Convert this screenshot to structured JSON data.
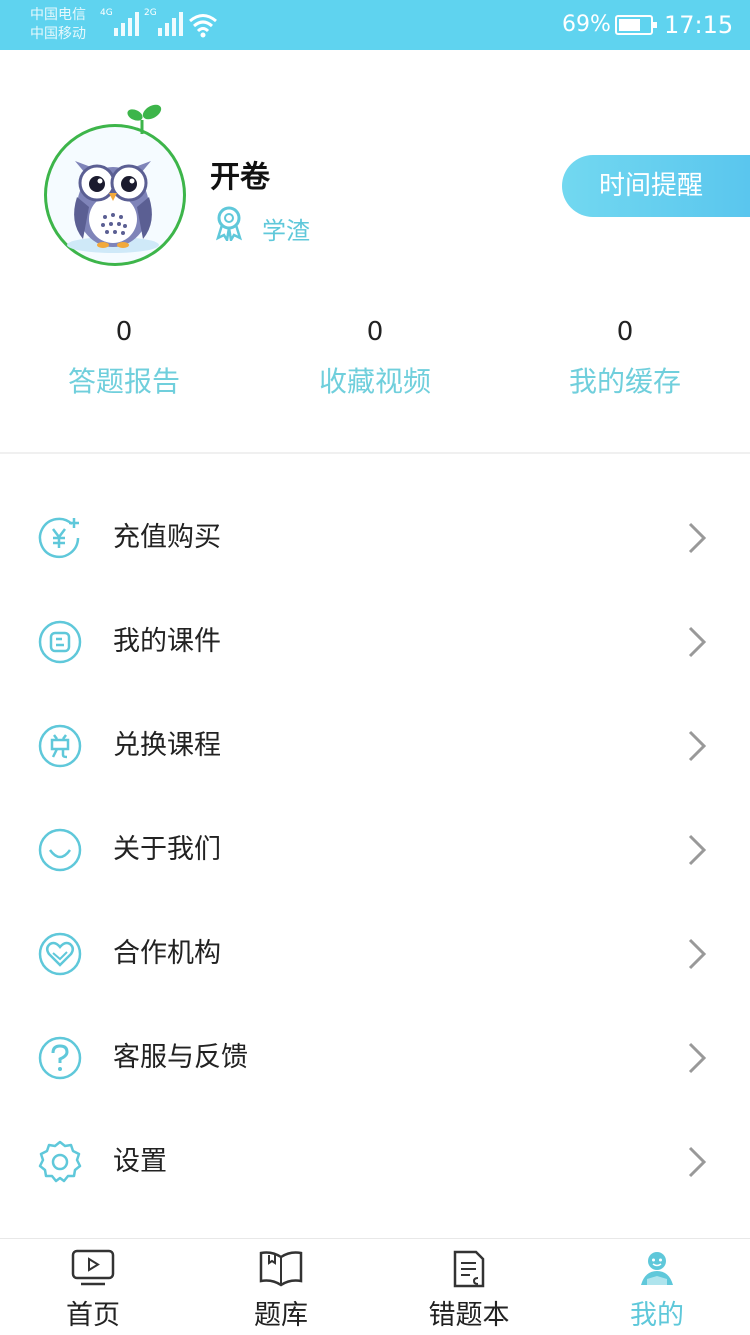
{
  "status_bar": {
    "carrier_1": "中国电信",
    "carrier_2": "中国移动",
    "sim1_net": "4G",
    "sim2_net": "2G",
    "battery": "69%",
    "time": "17:15"
  },
  "profile": {
    "name": "开卷",
    "level": "学渣",
    "reminder_button": "时间提醒"
  },
  "stats": [
    {
      "value": "0",
      "label": "答题报告"
    },
    {
      "value": "0",
      "label": "收藏视频"
    },
    {
      "value": "0",
      "label": "我的缓存"
    }
  ],
  "menu": [
    {
      "label": "充值购买",
      "icon": "yuen-plus-icon"
    },
    {
      "label": "我的课件",
      "icon": "courseware-icon"
    },
    {
      "label": "兑换课程",
      "icon": "redeem-icon"
    },
    {
      "label": "关于我们",
      "icon": "smile-icon"
    },
    {
      "label": "合作机构",
      "icon": "handshake-icon"
    },
    {
      "label": "客服与反馈",
      "icon": "question-icon"
    },
    {
      "label": "设置",
      "icon": "gear-icon"
    }
  ],
  "tabs": [
    {
      "label": "首页",
      "icon": "video-icon"
    },
    {
      "label": "题库",
      "icon": "book-icon"
    },
    {
      "label": "错题本",
      "icon": "notebook-icon"
    },
    {
      "label": "我的",
      "icon": "profile-icon",
      "active": true
    }
  ],
  "colors": {
    "accent": "#5fc8da",
    "status_bar": "#5fd3ef",
    "avatar_border": "#3db54a"
  }
}
